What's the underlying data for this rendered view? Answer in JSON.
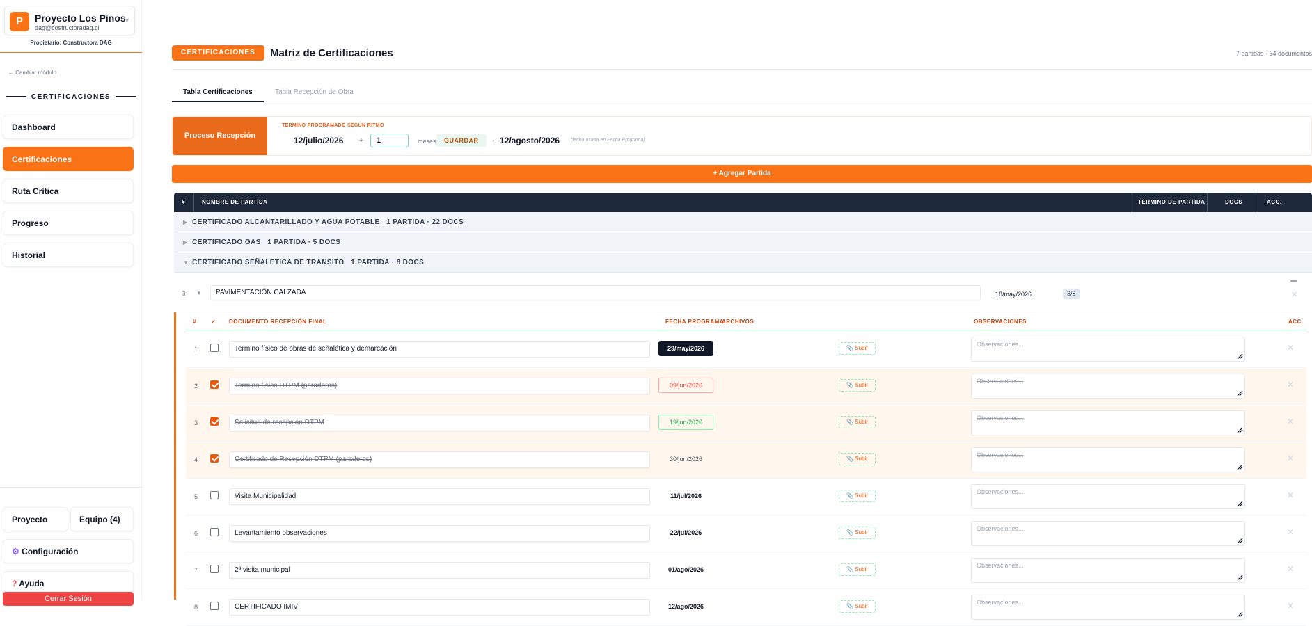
{
  "project": {
    "logo_letter": "P",
    "name": "Proyecto Los Pinos",
    "email": "dag@costructoradag.cl",
    "owner": "Propietario: Constructora DAG"
  },
  "sidebar": {
    "back_label": "← Cambiar módulo",
    "section_title": "CERTIFICACIONES",
    "items": [
      {
        "label": "Dashboard"
      },
      {
        "label": "Certificaciones"
      },
      {
        "label": "Ruta Crítica"
      },
      {
        "label": "Progreso"
      },
      {
        "label": "Historial"
      }
    ],
    "bottom": {
      "proyecto": "Proyecto",
      "equipo": "Equipo (4)",
      "configuracion": "Configuración",
      "ayuda": "Ayuda",
      "logout": "Cerrar Sesión"
    }
  },
  "header": {
    "badge": "CERTIFICACIONES",
    "title": "Matriz de Certificaciones",
    "counts": "7 partidas · 64 documentos"
  },
  "tabs": [
    {
      "label": "Tabla Certificaciones"
    },
    {
      "label": "Tabla Recepción de Obra"
    }
  ],
  "process": {
    "label": "Proceso Recepción",
    "term_label": "TERMINO PROGRAMADO SEGÚN RITMO",
    "start_date": "12/julio/2026",
    "plus": "+",
    "months_value": "1",
    "months_label": "meses",
    "save_label": "GUARDAR",
    "arrow": "→",
    "end_date": "12/agosto/2026",
    "end_note": "(fecha usada en Fecha Programa)"
  },
  "add_button": "+ Agregar Partida",
  "table": {
    "headers": {
      "num": "#",
      "name": "NOMBRE DE PARTIDA",
      "term": "TÉRMINO DE PARTIDA",
      "docs": "DOCS",
      "acc": "ACC."
    },
    "groups": [
      {
        "name": "CERTIFICADO ALCANTARILLADO Y AGUA POTABLE",
        "meta": "1 PARTIDA · 22 DOCS",
        "tri": "▶"
      },
      {
        "name": "CERTIFICADO GAS",
        "meta": "1 PARTIDA · 5 DOCS",
        "tri": "▶"
      },
      {
        "name": "CERTIFICADO SEÑALETICA DE TRANSITO",
        "meta": "1 PARTIDA · 8 DOCS",
        "tri": "▼"
      }
    ],
    "partida": {
      "num": "3",
      "name": "PAVIMENTACIÓN CALZADA",
      "term": "18/may/2026",
      "docs": "3/8"
    }
  },
  "documents": {
    "headers": {
      "num": "#",
      "check": "✓",
      "name": "DOCUMENTO RECEPCIÓN FINAL",
      "fecha": "FECHA PROGRAMA",
      "archivos": "ARCHIVOS",
      "obs": "OBSERVACIONES",
      "acc": "ACC."
    },
    "upload_label": "📎 Subir",
    "obs_placeholder": "Observaciones...",
    "rows": [
      {
        "num": "1",
        "name": "Termino físico de obras de señalética y demarcación",
        "fecha": "29/may/2026",
        "checked": false
      },
      {
        "num": "2",
        "name": "Termino físico DTPM (paraderos)",
        "fecha": "09/jun/2026",
        "checked": true
      },
      {
        "num": "3",
        "name": "Solicitud de recepción DTPM",
        "fecha": "19/jun/2026",
        "checked": true
      },
      {
        "num": "4",
        "name": "Certificado de Recepción DTPM (paraderos)",
        "fecha": "30/jun/2026",
        "checked": true
      },
      {
        "num": "5",
        "name": "Visita Municipalidad",
        "fecha": "11/jul/2026",
        "checked": false
      },
      {
        "num": "6",
        "name": "Levantamiento observaciones",
        "fecha": "22/jul/2026",
        "checked": false
      },
      {
        "num": "7",
        "name": "2ª visita municipal",
        "fecha": "01/ago/2026",
        "checked": false
      },
      {
        "num": "8",
        "name": "CERTIFICADO IMIV",
        "fecha": "12/ago/2026",
        "checked": false
      }
    ]
  },
  "colors": {
    "accent": "#f97316",
    "header_dark": "#1e293b",
    "logout": "#ef4444"
  }
}
